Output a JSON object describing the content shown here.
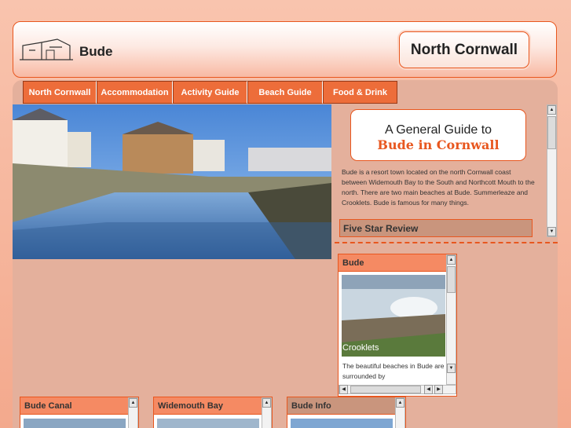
{
  "header": {
    "site_name": "Bude",
    "region_button": "North Cornwall",
    "logo_icon": "house-sketch-logo"
  },
  "nav": {
    "items": [
      "North Cornwall",
      "Accommodation",
      "Activity Guide",
      "Beach Guide",
      "Food & Drink"
    ]
  },
  "guide": {
    "line1": "A General Guide to",
    "line2": "Bude in Cornwall"
  },
  "intro": "Bude is a resort town located on the north Cornwall coast between Widemouth Bay to the South and Northcott Mouth to the north. There are two main beaches at Bude. Summerleaze and Crooklets. Bude is famous for many things.",
  "review_bar": "Five Star Review",
  "bude_widget": {
    "title": "Bude",
    "photo_caption": "Crooklets",
    "text": "The beautiful beaches in Bude are surrounded by"
  },
  "bottom_widgets": [
    "Bude Canal",
    "Widemouth Bay",
    "Bude Info"
  ],
  "colors": {
    "accent": "#e8571f",
    "tab": "#ed6d3a",
    "panel": "#e4b09c"
  }
}
